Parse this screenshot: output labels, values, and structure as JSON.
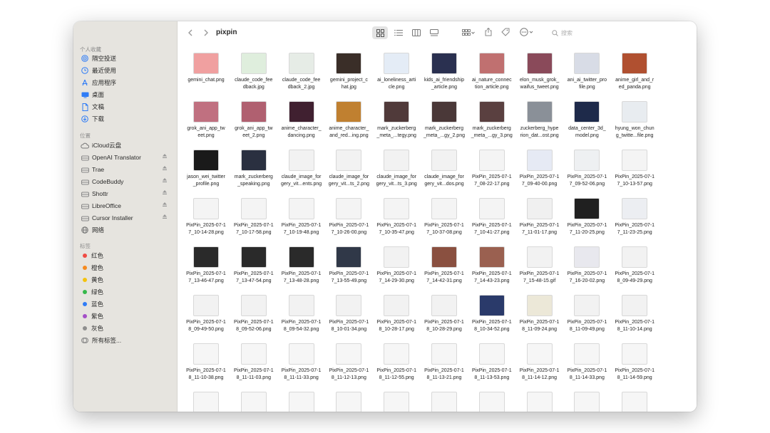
{
  "toolbar": {
    "title": "pixpin",
    "search_placeholder": "搜索",
    "icons": [
      "chevron-left-icon",
      "chevron-right-icon",
      "icon-view-icon",
      "list-view-icon",
      "column-view-icon",
      "gallery-view-icon",
      "group-icon",
      "share-icon",
      "tag-icon",
      "more-icon"
    ]
  },
  "sidebar": {
    "sections": {
      "favorites": "个人收藏",
      "locations": "位置",
      "tags": "标签"
    },
    "favorites": [
      {
        "label": "隔空投送",
        "icon": "airdrop-icon"
      },
      {
        "label": "最近使用",
        "icon": "clock-icon"
      },
      {
        "label": "应用程序",
        "icon": "apps-icon"
      },
      {
        "label": "桌面",
        "icon": "desktop-icon"
      },
      {
        "label": "文稿",
        "icon": "document-icon"
      },
      {
        "label": "下载",
        "icon": "download-icon"
      }
    ],
    "locations": [
      {
        "label": "iCloud云盘",
        "icon": "cloud-icon",
        "eject": false
      },
      {
        "label": "OpenAI Translator",
        "icon": "disk-icon",
        "eject": true
      },
      {
        "label": "Trae",
        "icon": "disk-icon",
        "eject": true
      },
      {
        "label": "CodeBuddy",
        "icon": "disk-icon",
        "eject": true
      },
      {
        "label": "Shottr",
        "icon": "disk-icon",
        "eject": true
      },
      {
        "label": "LibreOffice",
        "icon": "disk-icon",
        "eject": true
      },
      {
        "label": "Cursor Installer",
        "icon": "disk-icon",
        "eject": true
      },
      {
        "label": "网络",
        "icon": "globe-icon",
        "eject": false
      }
    ],
    "tags": [
      {
        "label": "红色",
        "color": "#f04b43"
      },
      {
        "label": "橙色",
        "color": "#f68a1f"
      },
      {
        "label": "黄色",
        "color": "#f4c20d"
      },
      {
        "label": "绿色",
        "color": "#36b84a"
      },
      {
        "label": "蓝色",
        "color": "#2f7cf6"
      },
      {
        "label": "紫色",
        "color": "#a44fc7"
      },
      {
        "label": "灰色",
        "color": "#8e8e8e"
      },
      {
        "label": "所有标签...",
        "color": ""
      }
    ]
  },
  "files": [
    {
      "line1": "gemini_chat.png",
      "line2": "",
      "thumb": "#f0a0a0"
    },
    {
      "line1": "claude_code_fee",
      "line2": "dback.jpg",
      "thumb": "#dfeedd"
    },
    {
      "line1": "claude_code_fee",
      "line2": "dback_2.jpg",
      "thumb": "#e6ece6"
    },
    {
      "line1": "gemini_project_c",
      "line2": "hat.jpg",
      "thumb": "#3a2e28"
    },
    {
      "line1": "ai_loneliness_arti",
      "line2": "cle.png",
      "thumb": "#e4ecf6"
    },
    {
      "line1": "kids_ai_friendship",
      "line2": "_article.png",
      "thumb": "#2a3050"
    },
    {
      "line1": "ai_nature_connec",
      "line2": "tion_article.png",
      "thumb": "#c07070"
    },
    {
      "line1": "elon_musk_grok_",
      "line2": "waifus_tweet.png",
      "thumb": "#8a4a5a"
    },
    {
      "line1": "ani_ai_twitter_pro",
      "line2": "file.png",
      "thumb": "#d8dce6"
    },
    {
      "line1": "anime_girl_and_r",
      "line2": "ed_panda.png",
      "thumb": "#b05030"
    },
    {
      "line1": "grok_ani_app_tw",
      "line2": "eet.png",
      "thumb": "#c07080"
    },
    {
      "line1": "grok_ani_app_tw",
      "line2": "eet_2.png",
      "thumb": "#b06070"
    },
    {
      "line1": "anime_character_",
      "line2": "dancing.png",
      "thumb": "#402030"
    },
    {
      "line1": "anime_character_",
      "line2": "and_red...ing.png",
      "thumb": "#c08030"
    },
    {
      "line1": "mark_zuckerberg",
      "line2": "_meta_...tegy.png",
      "thumb": "#503a3a"
    },
    {
      "line1": "mark_zuckerberg",
      "line2": "_meta_...gy_2.png",
      "thumb": "#4a3838"
    },
    {
      "line1": "mark_zuckerberg",
      "line2": "_meta_...gy_3.png",
      "thumb": "#5a4040"
    },
    {
      "line1": "zuckerberg_hype",
      "line2": "rion_dat...ost.png",
      "thumb": "#8a9098"
    },
    {
      "line1": "data_center_3d_",
      "line2": "model.png",
      "thumb": "#1e2a4a"
    },
    {
      "line1": "hyung_won_chun",
      "line2": "g_twitte...file.png",
      "thumb": "#e8ecf0"
    },
    {
      "line1": "jason_wei_twitter",
      "line2": "_profile.png",
      "thumb": "#1a1a1a"
    },
    {
      "line1": "mark_zuckerberg",
      "line2": "_speaking.png",
      "thumb": "#2a3040"
    },
    {
      "line1": "claude_image_for",
      "line2": "gery_vit...ents.png",
      "thumb": "#f2f2f2"
    },
    {
      "line1": "claude_image_for",
      "line2": "gery_vit...ts_2.png",
      "thumb": "#f2f2f2"
    },
    {
      "line1": "claude_image_for",
      "line2": "gery_vit...ts_3.png",
      "thumb": "#f2f2f2"
    },
    {
      "line1": "claude_image_for",
      "line2": "gery_vit...dos.png",
      "thumb": "#f2f2f2"
    },
    {
      "line1": "PixPin_2025-07-1",
      "line2": "7_08-22-17.png",
      "thumb": "#f4f4f4"
    },
    {
      "line1": "PixPin_2025-07-1",
      "line2": "7_09-40-00.png",
      "thumb": "#e6eaf4"
    },
    {
      "line1": "PixPin_2025-07-1",
      "line2": "7_09-52-06.png",
      "thumb": "#eef0f2"
    },
    {
      "line1": "PixPin_2025-07-1",
      "line2": "7_10-13-57.png",
      "thumb": "#f4f4f4"
    },
    {
      "line1": "PixPin_2025-07-1",
      "line2": "7_10-14-28.png",
      "thumb": "#f4f4f4"
    },
    {
      "line1": "PixPin_2025-07-1",
      "line2": "7_10-17-58.png",
      "thumb": "#f4f4f4"
    },
    {
      "line1": "PixPin_2025-07-1",
      "line2": "7_10-19-48.png",
      "thumb": "#f4f4f4"
    },
    {
      "line1": "PixPin_2025-07-1",
      "line2": "7_10-26-00.png",
      "thumb": "#f4f4f4"
    },
    {
      "line1": "PixPin_2025-07-1",
      "line2": "7_10-35-47.png",
      "thumb": "#f4f4f4"
    },
    {
      "line1": "PixPin_2025-07-1",
      "line2": "7_10-37-08.png",
      "thumb": "#f4f4f4"
    },
    {
      "line1": "PixPin_2025-07-1",
      "line2": "7_10-41-27.png",
      "thumb": "#f4f4f4"
    },
    {
      "line1": "PixPin_2025-07-1",
      "line2": "7_11-01-17.png",
      "thumb": "#f0f0f0"
    },
    {
      "line1": "PixPin_2025-07-1",
      "line2": "7_11-20-25.png",
      "thumb": "#202020"
    },
    {
      "line1": "PixPin_2025-07-1",
      "line2": "7_11-23-25.png",
      "thumb": "#eceef2"
    },
    {
      "line1": "PixPin_2025-07-1",
      "line2": "7_13-46-47.png",
      "thumb": "#2a2a2a"
    },
    {
      "line1": "PixPin_2025-07-1",
      "line2": "7_13-47-54.png",
      "thumb": "#2a2a2a"
    },
    {
      "line1": "PixPin_2025-07-1",
      "line2": "7_13-48-28.png",
      "thumb": "#2a2a2a"
    },
    {
      "line1": "PixPin_2025-07-1",
      "line2": "7_13-55-49.png",
      "thumb": "#303848"
    },
    {
      "line1": "PixPin_2025-07-1",
      "line2": "7_14-29-30.png",
      "thumb": "#f2f2f2"
    },
    {
      "line1": "PixPin_2025-07-1",
      "line2": "7_14-42-31.png",
      "thumb": "#8a5040"
    },
    {
      "line1": "PixPin_2025-07-1",
      "line2": "7_14-43-23.png",
      "thumb": "#9a6050"
    },
    {
      "line1": "PixPin_2025-07-1",
      "line2": "7_15-48-15.gif",
      "thumb": "#f2f2f2"
    },
    {
      "line1": "PixPin_2025-07-1",
      "line2": "7_16-20-02.png",
      "thumb": "#e8e8ee"
    },
    {
      "line1": "PixPin_2025-07-1",
      "line2": "8_09-49-29.png",
      "thumb": "#f2f2f2"
    },
    {
      "line1": "PixPin_2025-07-1",
      "line2": "8_09-49-50.png",
      "thumb": "#f2f2f2"
    },
    {
      "line1": "PixPin_2025-07-1",
      "line2": "8_09-52-06.png",
      "thumb": "#f2f2f2"
    },
    {
      "line1": "PixPin_2025-07-1",
      "line2": "8_09-54-32.png",
      "thumb": "#f2f2f2"
    },
    {
      "line1": "PixPin_2025-07-1",
      "line2": "8_10-01-34.png",
      "thumb": "#f2f2f2"
    },
    {
      "line1": "PixPin_2025-07-1",
      "line2": "8_10-28-17.png",
      "thumb": "#f2f2f2"
    },
    {
      "line1": "PixPin_2025-07-1",
      "line2": "8_10-28-29.png",
      "thumb": "#f2f2f2"
    },
    {
      "line1": "PixPin_2025-07-1",
      "line2": "8_10-34-52.png",
      "thumb": "#2a3a6a"
    },
    {
      "line1": "PixPin_2025-07-1",
      "line2": "8_11-09-24.png",
      "thumb": "#ece8d8"
    },
    {
      "line1": "PixPin_2025-07-1",
      "line2": "8_11-09-49.png",
      "thumb": "#f2f2f2"
    },
    {
      "line1": "PixPin_2025-07-1",
      "line2": "8_11-10-14.png",
      "thumb": "#f2f2f2"
    },
    {
      "line1": "PixPin_2025-07-1",
      "line2": "8_11-10-38.png",
      "thumb": "#f6f6f6"
    },
    {
      "line1": "PixPin_2025-07-1",
      "line2": "8_11-11-03.png",
      "thumb": "#f6f6f6"
    },
    {
      "line1": "PixPin_2025-07-1",
      "line2": "8_11-11-33.png",
      "thumb": "#f6f6f6"
    },
    {
      "line1": "PixPin_2025-07-1",
      "line2": "8_11-12-13.png",
      "thumb": "#f6f6f6"
    },
    {
      "line1": "PixPin_2025-07-1",
      "line2": "8_11-12-55.png",
      "thumb": "#f6f6f6"
    },
    {
      "line1": "PixPin_2025-07-1",
      "line2": "8_11-13-21.png",
      "thumb": "#f6f6f6"
    },
    {
      "line1": "PixPin_2025-07-1",
      "line2": "8_11-13-53.png",
      "thumb": "#f6f6f6"
    },
    {
      "line1": "PixPin_2025-07-1",
      "line2": "8_11-14-12.png",
      "thumb": "#f6f6f6"
    },
    {
      "line1": "PixPin_2025-07-1",
      "line2": "8_11-14-33.png",
      "thumb": "#f6f6f6"
    },
    {
      "line1": "PixPin_2025-07-1",
      "line2": "8_11-14-59.png",
      "thumb": "#f6f6f6"
    },
    {
      "line1": "",
      "line2": "",
      "thumb": "#f6f6f6"
    },
    {
      "line1": "",
      "line2": "",
      "thumb": "#f6f6f6"
    },
    {
      "line1": "",
      "line2": "",
      "thumb": "#f6f6f6"
    },
    {
      "line1": "",
      "line2": "",
      "thumb": "#f6f6f6"
    },
    {
      "line1": "",
      "line2": "",
      "thumb": "#f6f6f6"
    },
    {
      "line1": "",
      "line2": "",
      "thumb": "#f6f6f6"
    },
    {
      "line1": "",
      "line2": "",
      "thumb": "#f6f6f6"
    },
    {
      "line1": "",
      "line2": "",
      "thumb": "#f6f6f6"
    },
    {
      "line1": "",
      "line2": "",
      "thumb": "#f6f6f6"
    },
    {
      "line1": "",
      "line2": "",
      "thumb": "#f6f6f6"
    }
  ]
}
